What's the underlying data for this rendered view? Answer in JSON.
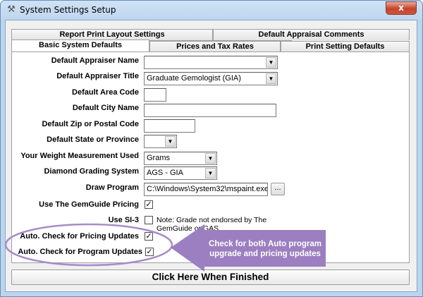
{
  "window": {
    "title": "System Settings Setup",
    "close_label": "x"
  },
  "tabs": {
    "back_row": [
      "Report Print Layout Settings",
      "Default Appraisal Comments"
    ],
    "front_row": [
      "Basic System Defaults",
      "Prices and Tax Rates",
      "Print Setting Defaults"
    ],
    "active": "Basic System Defaults"
  },
  "form": {
    "appraiser_name": {
      "label": "Default Appraiser Name",
      "value": ""
    },
    "appraiser_title": {
      "label": "Default Appraiser Title",
      "value": "Graduate Gemologist (GIA)"
    },
    "area_code": {
      "label": "Default Area Code",
      "value": ""
    },
    "city_name": {
      "label": "Default City Name",
      "value": ""
    },
    "zip_code": {
      "label": "Default Zip or Postal Code",
      "value": ""
    },
    "state": {
      "label": "Default State or Province",
      "value": ""
    },
    "weight_unit": {
      "label": "Your Weight Measurement Used",
      "value": "Grams"
    },
    "grading_system": {
      "label": "Diamond Grading System",
      "value": "AGS - GIA"
    },
    "draw_program": {
      "label": "Draw Program",
      "value": "C:\\Windows\\System32\\mspaint.exe",
      "browse_label": "..."
    },
    "gemguide_pricing": {
      "label": "Use The GemGuide Pricing",
      "checked": true
    },
    "si3": {
      "label": "Use SI-3",
      "checked": false,
      "note": "Note: Grade not endorsed by The GemGuide or GAS."
    },
    "pricing_updates": {
      "label": "Auto. Check for Pricing Updates",
      "checked": true
    },
    "program_updates": {
      "label": "Auto. Check for Program Updates",
      "checked": true
    }
  },
  "finish_button": "Click Here When Finished",
  "annotation": {
    "text": "Check for both Auto program upgrade and pricing updates",
    "color": "#9b7fc0",
    "ellipse_color": "#a58dc8"
  },
  "icons": {
    "app": "tools-icon",
    "dropdown": "chevron-down-icon",
    "check": "checkmark-icon"
  }
}
